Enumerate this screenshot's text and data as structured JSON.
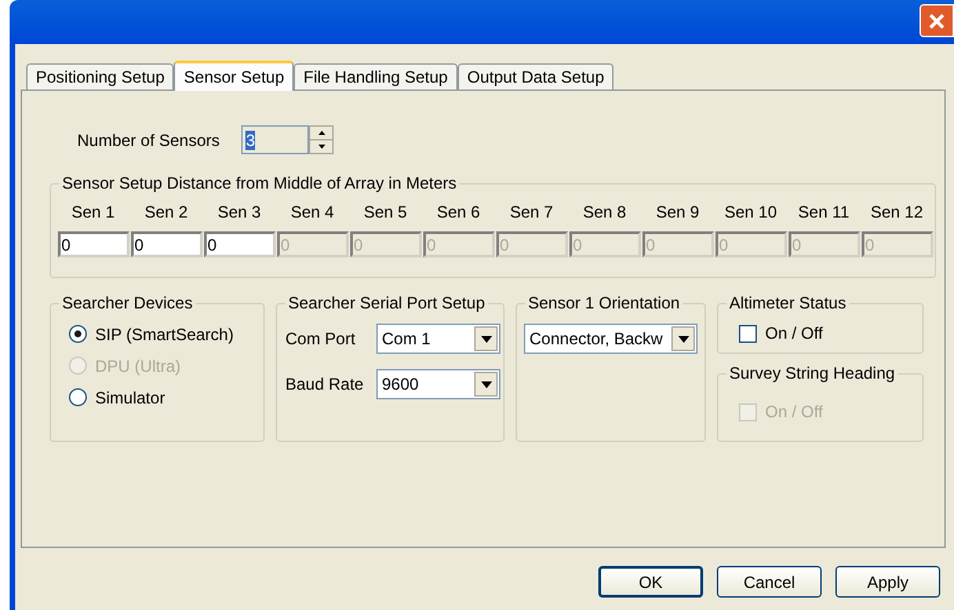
{
  "tabs": [
    {
      "label": "Positioning Setup",
      "selected": false
    },
    {
      "label": "Sensor Setup",
      "selected": true
    },
    {
      "label": "File Handling Setup",
      "selected": false
    },
    {
      "label": "Output Data Setup",
      "selected": false
    }
  ],
  "number_of_sensors": {
    "label": "Number of Sensors",
    "value": "3"
  },
  "distance_group": {
    "title": "Sensor Setup Distance from Middle of Array in Meters",
    "sensors": [
      {
        "label": "Sen 1",
        "value": "0",
        "disabled": false
      },
      {
        "label": "Sen 2",
        "value": "0",
        "disabled": false
      },
      {
        "label": "Sen 3",
        "value": "0",
        "disabled": false
      },
      {
        "label": "Sen 4",
        "value": "0",
        "disabled": true
      },
      {
        "label": "Sen 5",
        "value": "0",
        "disabled": true
      },
      {
        "label": "Sen 6",
        "value": "0",
        "disabled": true
      },
      {
        "label": "Sen 7",
        "value": "0",
        "disabled": true
      },
      {
        "label": "Sen 8",
        "value": "0",
        "disabled": true
      },
      {
        "label": "Sen 9",
        "value": "0",
        "disabled": true
      },
      {
        "label": "Sen 10",
        "value": "0",
        "disabled": true
      },
      {
        "label": "Sen 11",
        "value": "0",
        "disabled": true
      },
      {
        "label": "Sen 12",
        "value": "0",
        "disabled": true
      }
    ]
  },
  "searcher_devices": {
    "title": "Searcher Devices",
    "options": [
      {
        "label": "SIP (SmartSearch)",
        "selected": true,
        "disabled": false
      },
      {
        "label": "DPU (Ultra)",
        "selected": false,
        "disabled": true
      },
      {
        "label": "Simulator",
        "selected": false,
        "disabled": false
      }
    ]
  },
  "serial_port": {
    "title": "Searcher Serial Port Setup",
    "fields": [
      {
        "label": "Com Port",
        "value": "Com 1"
      },
      {
        "label": "Baud Rate",
        "value": "9600"
      }
    ]
  },
  "orientation": {
    "title": "Sensor 1 Orientation",
    "value": "Connector, Backw"
  },
  "altimeter": {
    "title": "Altimeter Status",
    "label": "On / Off",
    "checked": false,
    "disabled": false
  },
  "heading": {
    "title": "Survey String Heading",
    "label": "On / Off",
    "checked": false,
    "disabled": true
  },
  "buttons": [
    "OK",
    "Cancel",
    "Apply"
  ]
}
